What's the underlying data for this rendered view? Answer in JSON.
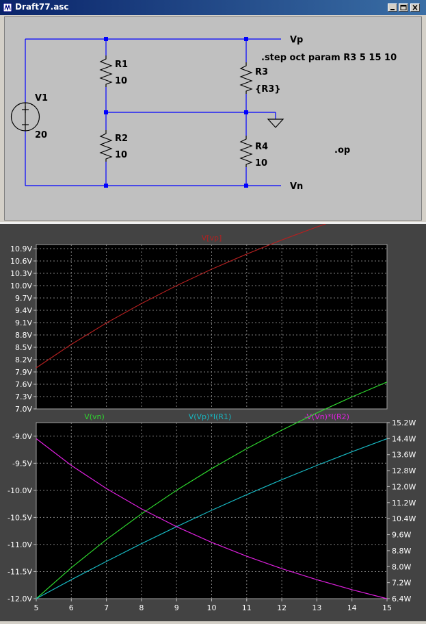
{
  "window": {
    "title": "Draft77.asc"
  },
  "schematic": {
    "labels": {
      "vp": "Vp",
      "vn": "Vn",
      "step": ".step oct param R3 5 15 10",
      "op": ".op",
      "v1_name": "V1",
      "v1_value": "20",
      "r1_name": "R1",
      "r1_value": "10",
      "r2_name": "R2",
      "r2_value": "10",
      "r3_name": "R3",
      "r3_value": "{R3}",
      "r4_name": "R4",
      "r4_value": "10"
    }
  },
  "colors": {
    "vp": "#b42020",
    "vn": "#2ed62e",
    "pr1": "#17b8c2",
    "pr2": "#e020e0"
  },
  "chart_data": [
    {
      "type": "line",
      "title": "V[vp]",
      "x": [
        5,
        6,
        7,
        8,
        9,
        10,
        11,
        12,
        13,
        14,
        15
      ],
      "ylim": [
        7.0,
        11.0
      ],
      "yticks": [
        "7.0V",
        "7.3V",
        "7.6V",
        "7.9V",
        "8.2V",
        "8.5V",
        "8.8V",
        "9.1V",
        "9.4V",
        "9.7V",
        "10.0V",
        "10.3V",
        "10.6V",
        "10.9V"
      ],
      "series": [
        {
          "name": "V[vp]",
          "values": [
            8.0,
            8.571,
            9.091,
            9.565,
            10.0,
            10.4,
            10.769,
            11.111,
            11.429,
            11.724,
            12.0
          ]
        }
      ]
    },
    {
      "type": "line",
      "x": [
        5,
        6,
        7,
        8,
        9,
        10,
        11,
        12,
        13,
        14,
        15
      ],
      "xticks": [
        "5",
        "6",
        "7",
        "8",
        "9",
        "10",
        "11",
        "12",
        "13",
        "14",
        "15"
      ],
      "ylim_left": [
        -12.0,
        -8.75
      ],
      "ylim_right": [
        6.4,
        15.2
      ],
      "yticks_left": [
        "-9.0V",
        "-9.5V",
        "-10.0V",
        "-10.5V",
        "-11.0V",
        "-11.5V",
        "-12.0V"
      ],
      "yticks_right": [
        "15.2W",
        "14.4W",
        "13.6W",
        "12.8W",
        "12.0W",
        "11.2W",
        "10.4W",
        "9.6W",
        "8.8W",
        "8.0W",
        "7.2W",
        "6.4W"
      ],
      "series": [
        {
          "name": "V(vn)",
          "axis": "left",
          "values": [
            -12.0,
            -11.429,
            -10.909,
            -10.435,
            -10.0,
            -9.6,
            -9.231,
            -8.889,
            -8.571,
            -8.276,
            -8.0
          ]
        },
        {
          "name": "V(Vp)*I(R1)",
          "axis": "right",
          "values": [
            6.4,
            7.347,
            8.264,
            9.149,
            10.0,
            10.816,
            11.598,
            12.346,
            13.06,
            13.741,
            14.4
          ]
        },
        {
          "name": "-V(Vn)*I(R2)",
          "axis": "right",
          "values": [
            14.4,
            13.06,
            11.901,
            10.889,
            10.0,
            9.216,
            8.521,
            7.901,
            7.347,
            6.849,
            6.4
          ]
        }
      ]
    }
  ]
}
